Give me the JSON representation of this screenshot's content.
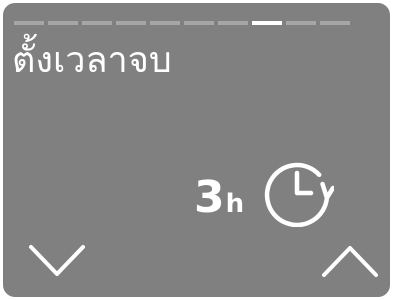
{
  "title": "ตั้งเวลาจบ",
  "progress": {
    "total_steps": 10,
    "current_step": 8
  },
  "value": {
    "number": "3",
    "unit": "h"
  },
  "icons": {
    "timer": "timer-clock-icon",
    "down": "chevron-down-icon",
    "up": "chevron-up-icon"
  },
  "colors": {
    "background": "#808080",
    "foreground": "#ffffff",
    "inactive_step": "#a6a6a6"
  }
}
